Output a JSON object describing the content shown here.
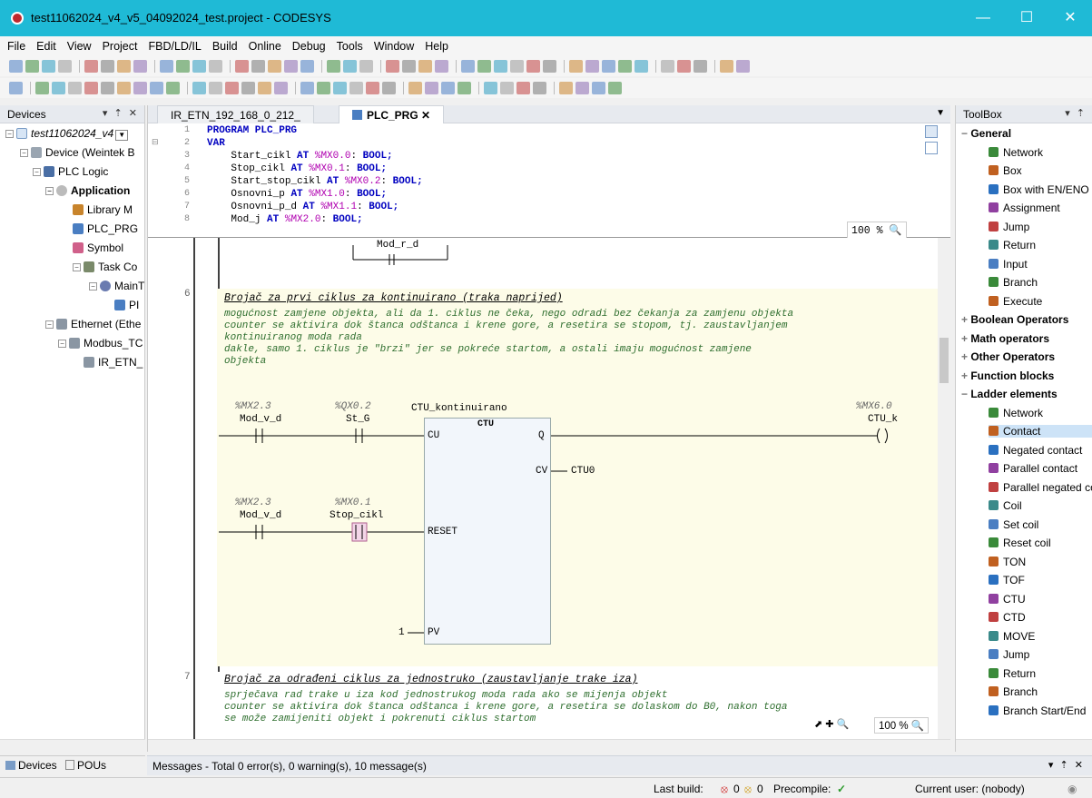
{
  "window": {
    "title": "test11062024_v4_v5_04092024_test.project - CODESYS"
  },
  "menu": [
    "File",
    "Edit",
    "View",
    "Project",
    "FBD/LD/IL",
    "Build",
    "Online",
    "Debug",
    "Tools",
    "Window",
    "Help"
  ],
  "devices": {
    "title": "Devices",
    "tree": [
      {
        "label": "test11062024_v4",
        "italic": true
      },
      {
        "label": "Device (Weintek B"
      },
      {
        "label": "PLC Logic"
      },
      {
        "label": "Application",
        "bold": true
      },
      {
        "label": "Library M"
      },
      {
        "label": "PLC_PRG"
      },
      {
        "label": "Symbol"
      },
      {
        "label": "Task Co"
      },
      {
        "label": "MainT"
      },
      {
        "label": "PI"
      },
      {
        "label": "Ethernet (Ethe"
      },
      {
        "label": "Modbus_TC"
      },
      {
        "label": "IR_ETN_"
      }
    ],
    "tabs": [
      "Devices",
      "POUs"
    ]
  },
  "editor": {
    "tabs": [
      "IR_ETN_192_168_0_212_",
      "PLC_PRG"
    ],
    "decl_lines": [
      {
        "n": "1",
        "text": "PROGRAM PLC_PRG"
      },
      {
        "n": "2",
        "text": "VAR"
      },
      {
        "n": "3",
        "name": "Start_cikl",
        "addr": "%MX0.0",
        "type": "BOOL;"
      },
      {
        "n": "4",
        "name": "Stop_cikl",
        "addr": "%MX0.1",
        "type": "BOOL;"
      },
      {
        "n": "5",
        "name": "Start_stop_cikl",
        "addr": "%MX0.2",
        "type": "BOOL;"
      },
      {
        "n": "6",
        "name": "Osnovni_p",
        "addr": "%MX1.0",
        "type": "BOOL;"
      },
      {
        "n": "7",
        "name": "Osnovni_p_d",
        "addr": "%MX1.1",
        "type": "BOOL;"
      },
      {
        "n": "8",
        "name": "Mod_j",
        "addr": "%MX2.0",
        "type": "BOOL;"
      }
    ],
    "decl_zoom": "100 %",
    "ladder_zoom": "100 %",
    "top_label": "Mod_r_d",
    "networks": [
      {
        "num": "6",
        "title": "Brojač za prvi ciklus za kontinuirano (traka naprijed)",
        "comment": "mogućnost zamjene objekta, ali da 1. ciklus ne čeka, nego odradi bez čekanja za zamjenu objekta\ncounter se aktivira dok štanca odštanca i krene gore, a resetira se stopom, tj. zaustavljanjem\nkontinuiranog moda rada\ndakle, samo 1. ciklus je \"brzi\" jer se pokreće startom, a ostali imaju mogućnost zamjene\nobjekta",
        "c1_addr": "%MX2.3",
        "c1_name": "Mod_v_d",
        "c2_addr": "%QX0.2",
        "c2_name": "St_G",
        "fb_instance": "CTU_kontinuirano",
        "fb_type": "CTU",
        "pin_cu": "CU",
        "pin_q": "Q",
        "pin_cv": "CV",
        "pin_reset": "RESET",
        "pin_pv": "PV",
        "cv_var": "CTU0",
        "pv_val": "1",
        "coil_addr": "%MX6.0",
        "coil_name": "CTU_k",
        "c3_addr": "%MX2.3",
        "c3_name": "Mod_v_d",
        "c4_addr": "%MX0.1",
        "c4_name": "Stop_cikl"
      },
      {
        "num": "7",
        "title": "Brojač za odrađeni ciklus za jednostruko (zaustavljanje trake iza)",
        "comment": "sprječava rad trake u iza kod jednostrukog moda rada ako se mijenja objekt\ncounter se aktivira dok štanca odštanca i krene gore, a resetira se dolaskom do B0, nakon toga\nse može zamijeniti objekt i pokrenuti ciklus startom"
      }
    ]
  },
  "toolbox": {
    "title": "ToolBox",
    "items": [
      {
        "label": "General",
        "cat": true,
        "open": true
      },
      {
        "label": "Network"
      },
      {
        "label": "Box"
      },
      {
        "label": "Box with EN/ENO"
      },
      {
        "label": "Assignment"
      },
      {
        "label": "Jump"
      },
      {
        "label": "Return"
      },
      {
        "label": "Input"
      },
      {
        "label": "Branch"
      },
      {
        "label": "Execute"
      },
      {
        "label": "Boolean Operators",
        "cat": true
      },
      {
        "label": "Math operators",
        "cat": true
      },
      {
        "label": "Other Operators",
        "cat": true
      },
      {
        "label": "Function blocks",
        "cat": true
      },
      {
        "label": "Ladder elements",
        "cat": true,
        "open": true
      },
      {
        "label": "Network"
      },
      {
        "label": "Contact",
        "selected": true
      },
      {
        "label": "Negated contact"
      },
      {
        "label": "Parallel contact"
      },
      {
        "label": "Parallel negated co"
      },
      {
        "label": "Coil"
      },
      {
        "label": "Set coil"
      },
      {
        "label": "Reset coil"
      },
      {
        "label": "TON"
      },
      {
        "label": "TOF"
      },
      {
        "label": "CTU"
      },
      {
        "label": "CTD"
      },
      {
        "label": "MOVE"
      },
      {
        "label": "Jump"
      },
      {
        "label": "Return"
      },
      {
        "label": "Branch"
      },
      {
        "label": "Branch Start/End"
      }
    ]
  },
  "messages": "Messages - Total 0 error(s), 0 warning(s), 10 message(s)",
  "status": {
    "last_build": "Last build:",
    "errors": "0",
    "warnings": "0",
    "precompile": "Precompile:",
    "user": "Current user: (nobody)"
  }
}
